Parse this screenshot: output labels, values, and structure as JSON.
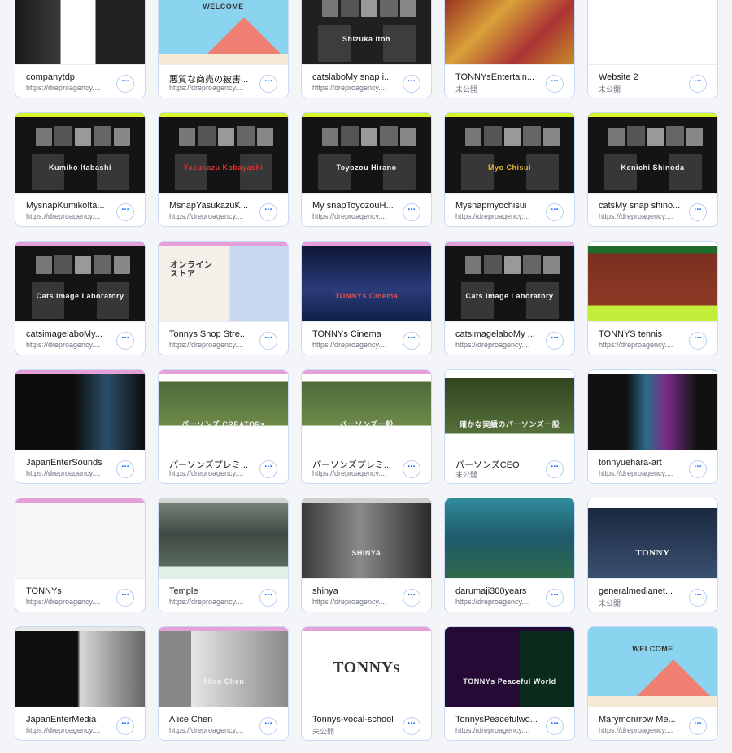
{
  "more_glyph": "···",
  "sites": [
    {
      "name": "companytdp",
      "status": "https://dreproagency...."
    },
    {
      "name": "悪質な商売の被害...",
      "status": "https://dreproagency...."
    },
    {
      "name": "catslaboMy snap i...",
      "status": "https://dreproagency...."
    },
    {
      "name": "TONNYsEntertain...",
      "status": "未公開"
    },
    {
      "name": "Website 2",
      "status": "未公開"
    },
    {
      "name": "MysnapKumikoIta...",
      "status": "https://dreproagency...."
    },
    {
      "name": "MsnapYasukazuK...",
      "status": "https://dreproagency...."
    },
    {
      "name": "My snapToyozouH...",
      "status": "https://dreproagency...."
    },
    {
      "name": "Mysnapmyochisui",
      "status": "https://dreproagency...."
    },
    {
      "name": "catsMy snap shino...",
      "status": "https://dreproagency...."
    },
    {
      "name": "catsimagelaboMy...",
      "status": "https://dreproagency...."
    },
    {
      "name": "Tonnys Shop Stre...",
      "status": "https://dreproagency...."
    },
    {
      "name": "TONNYs Cinema",
      "status": "https://dreproagency...."
    },
    {
      "name": "catsimagelaboMy ...",
      "status": "https://dreproagency...."
    },
    {
      "name": "TONNYS tennis",
      "status": "https://dreproagency...."
    },
    {
      "name": "JapanEnterSounds",
      "status": "https://dreproagency...."
    },
    {
      "name": "パーソンズプレミ...",
      "status": "https://dreproagency...."
    },
    {
      "name": "パーソンズプレミ...",
      "status": "https://dreproagency...."
    },
    {
      "name": "パーソンズCEO",
      "status": "未公開"
    },
    {
      "name": "tonnyuehara-art",
      "status": "https://dreproagency...."
    },
    {
      "name": "TONNYs",
      "status": "https://dreproagency...."
    },
    {
      "name": "Temple",
      "status": "https://dreproagency...."
    },
    {
      "name": "shinya",
      "status": "https://dreproagency...."
    },
    {
      "name": "darumaji300years",
      "status": "https://dreproagency...."
    },
    {
      "name": "generalmedianet...",
      "status": "未公開"
    },
    {
      "name": "JapanEnterMedia",
      "status": "https://dreproagency...."
    },
    {
      "name": "Alice Chen",
      "status": "https://dreproagency...."
    },
    {
      "name": "Tonnys-vocal-school",
      "status": "未公開"
    },
    {
      "name": "TonnysPeacefulwo...",
      "status": "https://dreproagency...."
    },
    {
      "name": "Marymonrrow Me...",
      "status": "https://dreproagency...."
    }
  ],
  "thumbs": {
    "t2": "WELCOME",
    "t3": "Shizuka Itoh",
    "t6": "Kumiko Itabashi",
    "t7": "Yasukazu Kobayashi",
    "t8": "Toyozou Hirano",
    "t9": "Myo Chisui",
    "t10": "Kenichi Shinoda",
    "t11": "Cats Image Laboratory",
    "t12": "オンライン ストア",
    "t13": "TONNYs Cinema",
    "t14": "Cats Image Laboratory",
    "t17": "パーソンズ CREATORs",
    "t18": "パーソンズ一般",
    "t19": "確かな実績のパーソンズ一般",
    "t23": "SHINYA",
    "t25": "TONNY",
    "t27": "Alice Chen",
    "t28": "TONNYs",
    "t29": "TONNYs Peaceful World",
    "t30": "WELCOME"
  },
  "colors": {
    "card_border": "#c9daf7",
    "action_blue": "#116dff",
    "lime_band": "#d6f52b",
    "pink_band": "#e6a0d8"
  }
}
